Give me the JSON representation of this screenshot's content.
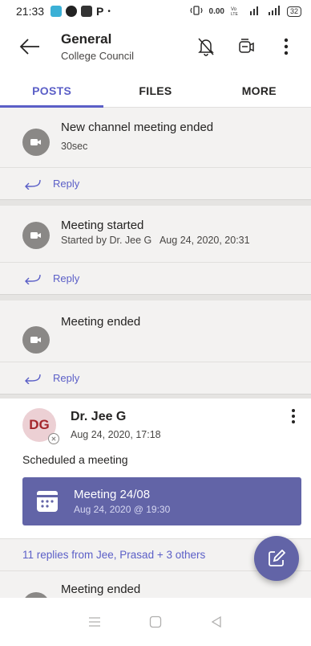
{
  "status_bar": {
    "time": "21:33",
    "net_speed": "0.00",
    "battery": "32"
  },
  "header": {
    "title": "General",
    "subtitle": "College Council"
  },
  "tabs": [
    {
      "label": "POSTS",
      "active": true
    },
    {
      "label": "FILES",
      "active": false
    },
    {
      "label": "MORE",
      "active": false
    }
  ],
  "feed": {
    "items": [
      {
        "title": "New channel meeting ended",
        "sub": "30sec",
        "reply": "Reply"
      },
      {
        "title": "Meeting started",
        "sub": "Started by Dr. Jee G   Aug 24, 2020, 20:31",
        "reply": "Reply"
      },
      {
        "title": "Meeting ended",
        "sub": "",
        "reply": "Reply"
      }
    ],
    "post": {
      "initials": "DG",
      "author": "Dr. Jee G",
      "time": "Aug 24, 2020, 17:18",
      "text": "Scheduled a meeting",
      "meeting_title": "Meeting 24/08",
      "meeting_time": "Aug 24, 2020 @ 19:30"
    },
    "replies_summary": "11 replies from Jee, Prasad + 3 others",
    "last_item": {
      "title": "Meeting ended"
    }
  },
  "colors": {
    "accent": "#5b5fc7",
    "meeting_card": "#6264a7",
    "avatar_bg": "#ecd0d4",
    "avatar_text": "#a4262c"
  },
  "icons": {
    "back": "arrow-left-icon",
    "mute": "bell-off-icon",
    "meet": "video-camera-icon",
    "more": "more-vertical-icon",
    "meeting": "video-icon",
    "reply": "reply-arrow-icon",
    "calendar": "calendar-icon",
    "compose": "compose-icon"
  }
}
